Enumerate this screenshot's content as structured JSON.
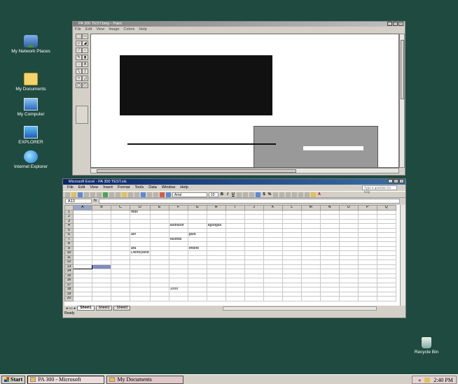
{
  "desktop": {
    "icons": [
      {
        "label": "My Network Places",
        "icon": "network-places-icon"
      },
      {
        "label": "My Documents",
        "icon": "my-documents-icon"
      },
      {
        "label": "My Computer",
        "icon": "my-computer-icon"
      },
      {
        "label": "EXPLORER",
        "icon": "explorer-icon"
      },
      {
        "label": "Internet Explorer",
        "icon": "internet-explorer-icon"
      }
    ],
    "recycle_bin": "Recycle Bin"
  },
  "paint": {
    "title": "PA 300 TEST.bmp - Paint",
    "menu": [
      "File",
      "Edit",
      "View",
      "Image",
      "Colors",
      "Help"
    ]
  },
  "excel": {
    "title": "Microsoft Excel - PA 300 TEST.xls",
    "menu": [
      "File",
      "Edit",
      "View",
      "Insert",
      "Format",
      "Tools",
      "Data",
      "Window",
      "Help"
    ],
    "help_placeholder": "Type a question for help",
    "font": "Arial",
    "font_size": "10",
    "name_box": "A13",
    "fx": "fx",
    "columns": [
      "A",
      "B",
      "C",
      "D",
      "E",
      "F",
      "G",
      "H",
      "I",
      "J",
      "K",
      "L",
      "M",
      "N",
      "O",
      "P",
      "Q"
    ],
    "rows": [
      {
        "n": "1",
        "cells": {
          "D": "dfas"
        }
      },
      {
        "n": "2",
        "cells": {}
      },
      {
        "n": "3",
        "cells": {}
      },
      {
        "n": "4",
        "cells": {
          "F": "asdfasdf",
          "H": "agsdgas"
        }
      },
      {
        "n": "5",
        "cells": {}
      },
      {
        "n": "6",
        "cells": {
          "D": "asf",
          "G": "gald"
        }
      },
      {
        "n": "7",
        "cells": {
          "F": "fasdfds"
        }
      },
      {
        "n": "8",
        "cells": {}
      },
      {
        "n": "9",
        "cells": {
          "D": "afa",
          "G": "dfdsfd"
        }
      },
      {
        "n": "10",
        "cells": {
          "D": "Disneyland"
        }
      },
      {
        "n": "11",
        "cells": {}
      },
      {
        "n": "12",
        "cells": {}
      },
      {
        "n": "13",
        "cells": {}
      },
      {
        "n": "14",
        "cells": {}
      },
      {
        "n": "15",
        "cells": {}
      },
      {
        "n": "16",
        "cells": {}
      },
      {
        "n": "17",
        "cells": {}
      },
      {
        "n": "18",
        "cells": {
          "F": "1000'"
        }
      },
      {
        "n": "19",
        "cells": {}
      },
      {
        "n": "20",
        "cells": {}
      }
    ],
    "sheets": [
      "Sheet1",
      "Sheet2",
      "Sheet3"
    ],
    "status": "Ready"
  },
  "taskbar": {
    "start": "Start",
    "buttons": [
      "PA 300 - Microsoft",
      "My Documents"
    ],
    "clock": "2:40 PM"
  }
}
